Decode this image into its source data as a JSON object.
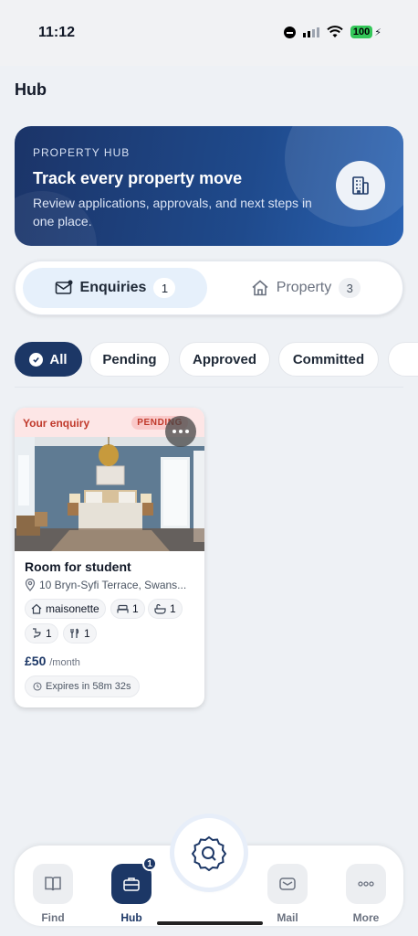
{
  "status_bar": {
    "time": "11:12",
    "battery": "100"
  },
  "page": {
    "title": "Hub"
  },
  "hero": {
    "eyebrow": "PROPERTY HUB",
    "title": "Track every property move",
    "subtitle": "Review applications, approvals, and next steps in one place.",
    "icon": "building-icon"
  },
  "segments": [
    {
      "label": "Enquiries",
      "count": "1",
      "icon": "mail-icon",
      "active": true
    },
    {
      "label": "Property",
      "count": "3",
      "icon": "home-icon",
      "active": false
    }
  ],
  "filters": [
    {
      "label": "All",
      "selected": true
    },
    {
      "label": "Pending",
      "selected": false
    },
    {
      "label": "Approved",
      "selected": false
    },
    {
      "label": "Committed",
      "selected": false
    }
  ],
  "card": {
    "label": "Your enquiry",
    "status": "PENDING",
    "title": "Room for student",
    "address": "10 Bryn-Syfi Terrace, Swans...",
    "property_type": "maisonette",
    "bedrooms": "1",
    "bathrooms": "1",
    "toilets": "1",
    "kitchens": "1",
    "price": "£50",
    "price_unit": "/month",
    "expires": "Expires in 58m 32s"
  },
  "bottom_nav": [
    {
      "label": "Find",
      "icon": "book-icon"
    },
    {
      "label": "Hub",
      "icon": "briefcase-icon",
      "badge": "1"
    },
    {
      "label": "Mail",
      "icon": "mail-icon"
    },
    {
      "label": "More",
      "icon": "more-dots-icon"
    }
  ],
  "colors": {
    "primary": "#1c3766",
    "pending": "#c0392b",
    "hero_start": "#1b3468",
    "hero_end": "#2a63b3"
  }
}
